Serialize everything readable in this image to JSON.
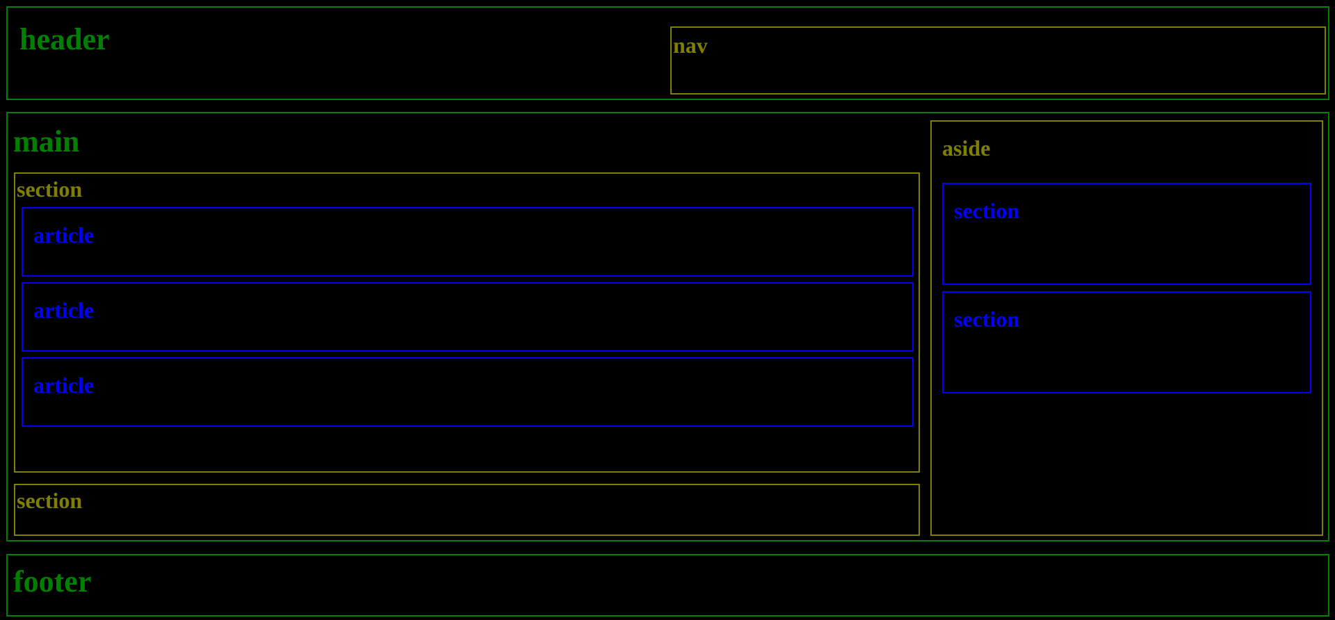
{
  "header": {
    "label": "header",
    "nav": {
      "label": "nav"
    }
  },
  "main": {
    "label": "main",
    "section_primary": {
      "label": "section",
      "articles": [
        {
          "label": "article"
        },
        {
          "label": "article"
        },
        {
          "label": "article"
        }
      ]
    },
    "section_secondary": {
      "label": "section"
    },
    "aside": {
      "label": "aside",
      "sections": [
        {
          "label": "section"
        },
        {
          "label": "section"
        }
      ]
    }
  },
  "footer": {
    "label": "footer"
  },
  "colors": {
    "background": "#000000",
    "landmark": "#008000",
    "container": "#808000",
    "content": "#0000ff"
  }
}
